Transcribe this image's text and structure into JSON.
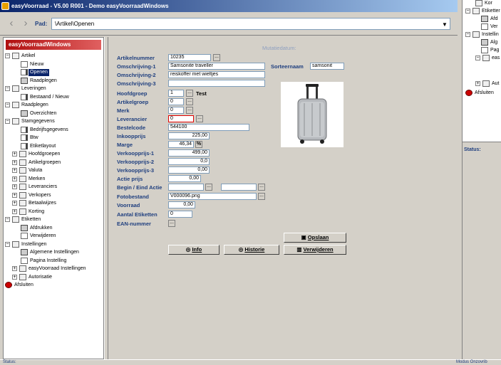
{
  "window": {
    "title": "easyVoorraad - V5.00 R001 - Demo easyVoorraadWindows"
  },
  "toolbar": {
    "back_icon": "chevron-left-icon",
    "forward_icon": "chevron-right-icon",
    "pad_label": "Pad:",
    "path": "\\Artikel\\Openen",
    "dropdown_icon": "triangle-down-icon"
  },
  "sidebar": {
    "logo": "easyVoorraadWindows",
    "tree": [
      {
        "label": "Artikel",
        "level": 0,
        "icon": "folder",
        "exp": "−"
      },
      {
        "label": "Nieuw",
        "level": 1,
        "icon": "doc"
      },
      {
        "label": "Openen",
        "level": 1,
        "icon": "pen",
        "selected": true
      },
      {
        "label": "Raadplegen",
        "level": 1,
        "icon": "printer"
      },
      {
        "label": "Leveringen",
        "level": 0,
        "icon": "folder",
        "exp": "−"
      },
      {
        "label": "Bestaand / Nieuw",
        "level": 1,
        "icon": "pen"
      },
      {
        "label": "Raadplegen",
        "level": 0,
        "icon": "folder",
        "exp": "−"
      },
      {
        "label": "Overzichten",
        "level": 1,
        "icon": "printer"
      },
      {
        "label": "Stamgegevens",
        "level": 0,
        "icon": "folder",
        "exp": "−"
      },
      {
        "label": "Bedrijfsgegevens",
        "level": 1,
        "icon": "pen"
      },
      {
        "label": "Btw",
        "level": 1,
        "icon": "pen"
      },
      {
        "label": "Etiketlayout",
        "level": 1,
        "icon": "pen"
      },
      {
        "label": "Hoofdgroepen",
        "level": 1,
        "icon": "folder",
        "exp": "+"
      },
      {
        "label": "Artikelgroepen",
        "level": 1,
        "icon": "folder",
        "exp": "+"
      },
      {
        "label": "Valuta",
        "level": 1,
        "icon": "folder",
        "exp": "+"
      },
      {
        "label": "Merken",
        "level": 1,
        "icon": "folder",
        "exp": "+"
      },
      {
        "label": "Leveranciers",
        "level": 1,
        "icon": "folder",
        "exp": "+"
      },
      {
        "label": "Verkopers",
        "level": 1,
        "icon": "folder",
        "exp": "+"
      },
      {
        "label": "Betaalwijzes",
        "level": 1,
        "icon": "folder",
        "exp": "+"
      },
      {
        "label": "Korting",
        "level": 1,
        "icon": "folder",
        "exp": "+"
      },
      {
        "label": "Etiketten",
        "level": 0,
        "icon": "folder",
        "exp": "−"
      },
      {
        "label": "Afdrukken",
        "level": 1,
        "icon": "printer"
      },
      {
        "label": "Verwijderen",
        "level": 1,
        "icon": "doc"
      },
      {
        "label": "Instellingen",
        "level": 0,
        "icon": "folder",
        "exp": "−"
      },
      {
        "label": "Algemene Instellingen",
        "level": 1,
        "icon": "printer"
      },
      {
        "label": "Pagina Instelling",
        "level": 1,
        "icon": "doc"
      },
      {
        "label": "easyVoorraad Instellingen",
        "level": 1,
        "icon": "folder",
        "exp": "+"
      },
      {
        "label": "Autorisatie",
        "level": 1,
        "icon": "folder",
        "exp": "+"
      },
      {
        "label": "Afsluiten",
        "level": 0,
        "icon": "red"
      }
    ]
  },
  "form": {
    "mutatiedatum_label": "Mutatiedatum:",
    "artikelnummer": {
      "label": "Artikelnummer",
      "value": "10235"
    },
    "omschrijving1": {
      "label": "Omschrijving-1",
      "value": "Samsonite traveller"
    },
    "sorteernaam": {
      "label": "Sorteernaam",
      "value": "samsonit"
    },
    "omschrijving2": {
      "label": "Omschrijving-2",
      "value": "reiskoffer met wieltjes"
    },
    "omschrijving3": {
      "label": "Omschrijving-3",
      "value": ""
    },
    "hoofdgroep": {
      "label": "Hoofdgroep",
      "value": "1",
      "desc": "Test"
    },
    "artikelgroep": {
      "label": "Artikelgroep",
      "value": "0"
    },
    "merk": {
      "label": "Merk",
      "value": "0"
    },
    "leverancier": {
      "label": "Leverancier",
      "value": "0"
    },
    "bestelcode": {
      "label": "Bestelcode",
      "value": "544100"
    },
    "inkoopprijs": {
      "label": "Inkoopprijs",
      "value": "225,00"
    },
    "marge": {
      "label": "Marge",
      "value": "46,34",
      "unit": "%"
    },
    "verkoopprijs1": {
      "label": "Verkoopprijs-1",
      "value": "499,00"
    },
    "verkoopprijs2": {
      "label": "Verkoopprijs-2",
      "value": "0,0"
    },
    "verkoopprijs3": {
      "label": "Verkoopprijs-3",
      "value": "0,00"
    },
    "actieprijs": {
      "label": "Actie prijs",
      "value": "0,00"
    },
    "begin_eind_actie": {
      "label": "Begin / Eind Actie",
      "begin": "",
      "eind": ""
    },
    "fotobestand": {
      "label": "Fotobestand",
      "value": "V000096.png"
    },
    "voorraad": {
      "label": "Voorraad",
      "value": "0,00"
    },
    "aantal_etiketten": {
      "label": "Aantal Etiketten",
      "value": "0"
    },
    "ean": {
      "label": "EAN-nummer"
    },
    "ellipsis": "..."
  },
  "buttons": {
    "opslaan": "Opslaan",
    "info": "Info",
    "historie": "Historie",
    "verwijderen": "Verwijderen"
  },
  "right_panel": {
    "items": [
      "Kor",
      "Etiketter",
      "Afd",
      "Ver",
      "Instellin",
      "Alg",
      "Pag",
      "eas",
      "Aut",
      "Afsluiten"
    ],
    "status_label": "Status:"
  },
  "statusbar": {
    "left": "Status:",
    "right": "Modus Onzovrib"
  }
}
